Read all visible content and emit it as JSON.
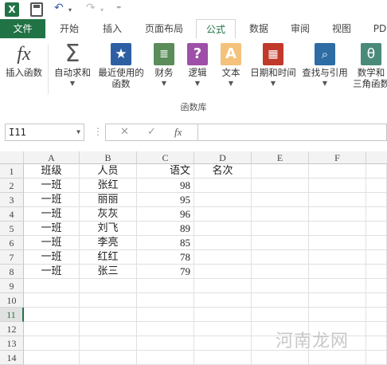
{
  "qat": {
    "logo": "X",
    "undo": "↶",
    "redo": "↷",
    "more": "⁼"
  },
  "tabs": [
    {
      "label": "文件"
    },
    {
      "label": "开始"
    },
    {
      "label": "插入"
    },
    {
      "label": "页面布局"
    },
    {
      "label": "公式"
    },
    {
      "label": "数据"
    },
    {
      "label": "审阅"
    },
    {
      "label": "视图"
    },
    {
      "label": "PD"
    }
  ],
  "ribbon": {
    "buttons": [
      {
        "label": "插入函数",
        "icon": "fx-icon",
        "color": "#444444"
      },
      {
        "label": "自动求和",
        "icon": "sigma-icon",
        "color": "#555555"
      },
      {
        "label": "最近使用的\n函数",
        "icon": "star-icon",
        "color": "#2e5fa3"
      },
      {
        "label": "财务",
        "icon": "coins-icon",
        "color": "#5b8c5a"
      },
      {
        "label": "逻辑",
        "icon": "question-icon",
        "color": "#9e4fa7"
      },
      {
        "label": "文本",
        "icon": "text-a-icon",
        "color": "#e8a32c"
      },
      {
        "label": "日期和时间",
        "icon": "calendar-icon",
        "color": "#c0392b"
      },
      {
        "label": "查找与引用",
        "icon": "magnifier-icon",
        "color": "#2e6da4"
      },
      {
        "label": "数学和\n三角函数",
        "icon": "theta-icon",
        "color": "#4a8a7a"
      }
    ],
    "group": "函数库"
  },
  "formula_bar": {
    "name_box": "I11",
    "cancel": "✕",
    "enter": "✓",
    "fx": "fx",
    "formula": ""
  },
  "columns": [
    "A",
    "B",
    "C",
    "D",
    "E",
    "F"
  ],
  "rows": [
    "1",
    "2",
    "3",
    "4",
    "5",
    "6",
    "7",
    "8",
    "9",
    "10",
    "11",
    "12",
    "13",
    "14"
  ],
  "selected_cell": "I11",
  "cells": {
    "header": [
      "班级",
      "人员",
      "语文",
      "名次"
    ],
    "data": [
      [
        "一班",
        "张红",
        "98"
      ],
      [
        "一班",
        "丽丽",
        "95"
      ],
      [
        "一班",
        "灰灰",
        "96"
      ],
      [
        "一班",
        "刘飞",
        "89"
      ],
      [
        "一班",
        "李亮",
        "85"
      ],
      [
        "一班",
        "红红",
        "78"
      ],
      [
        "一班",
        "张三",
        "79"
      ]
    ]
  },
  "watermark": "河南龙网"
}
